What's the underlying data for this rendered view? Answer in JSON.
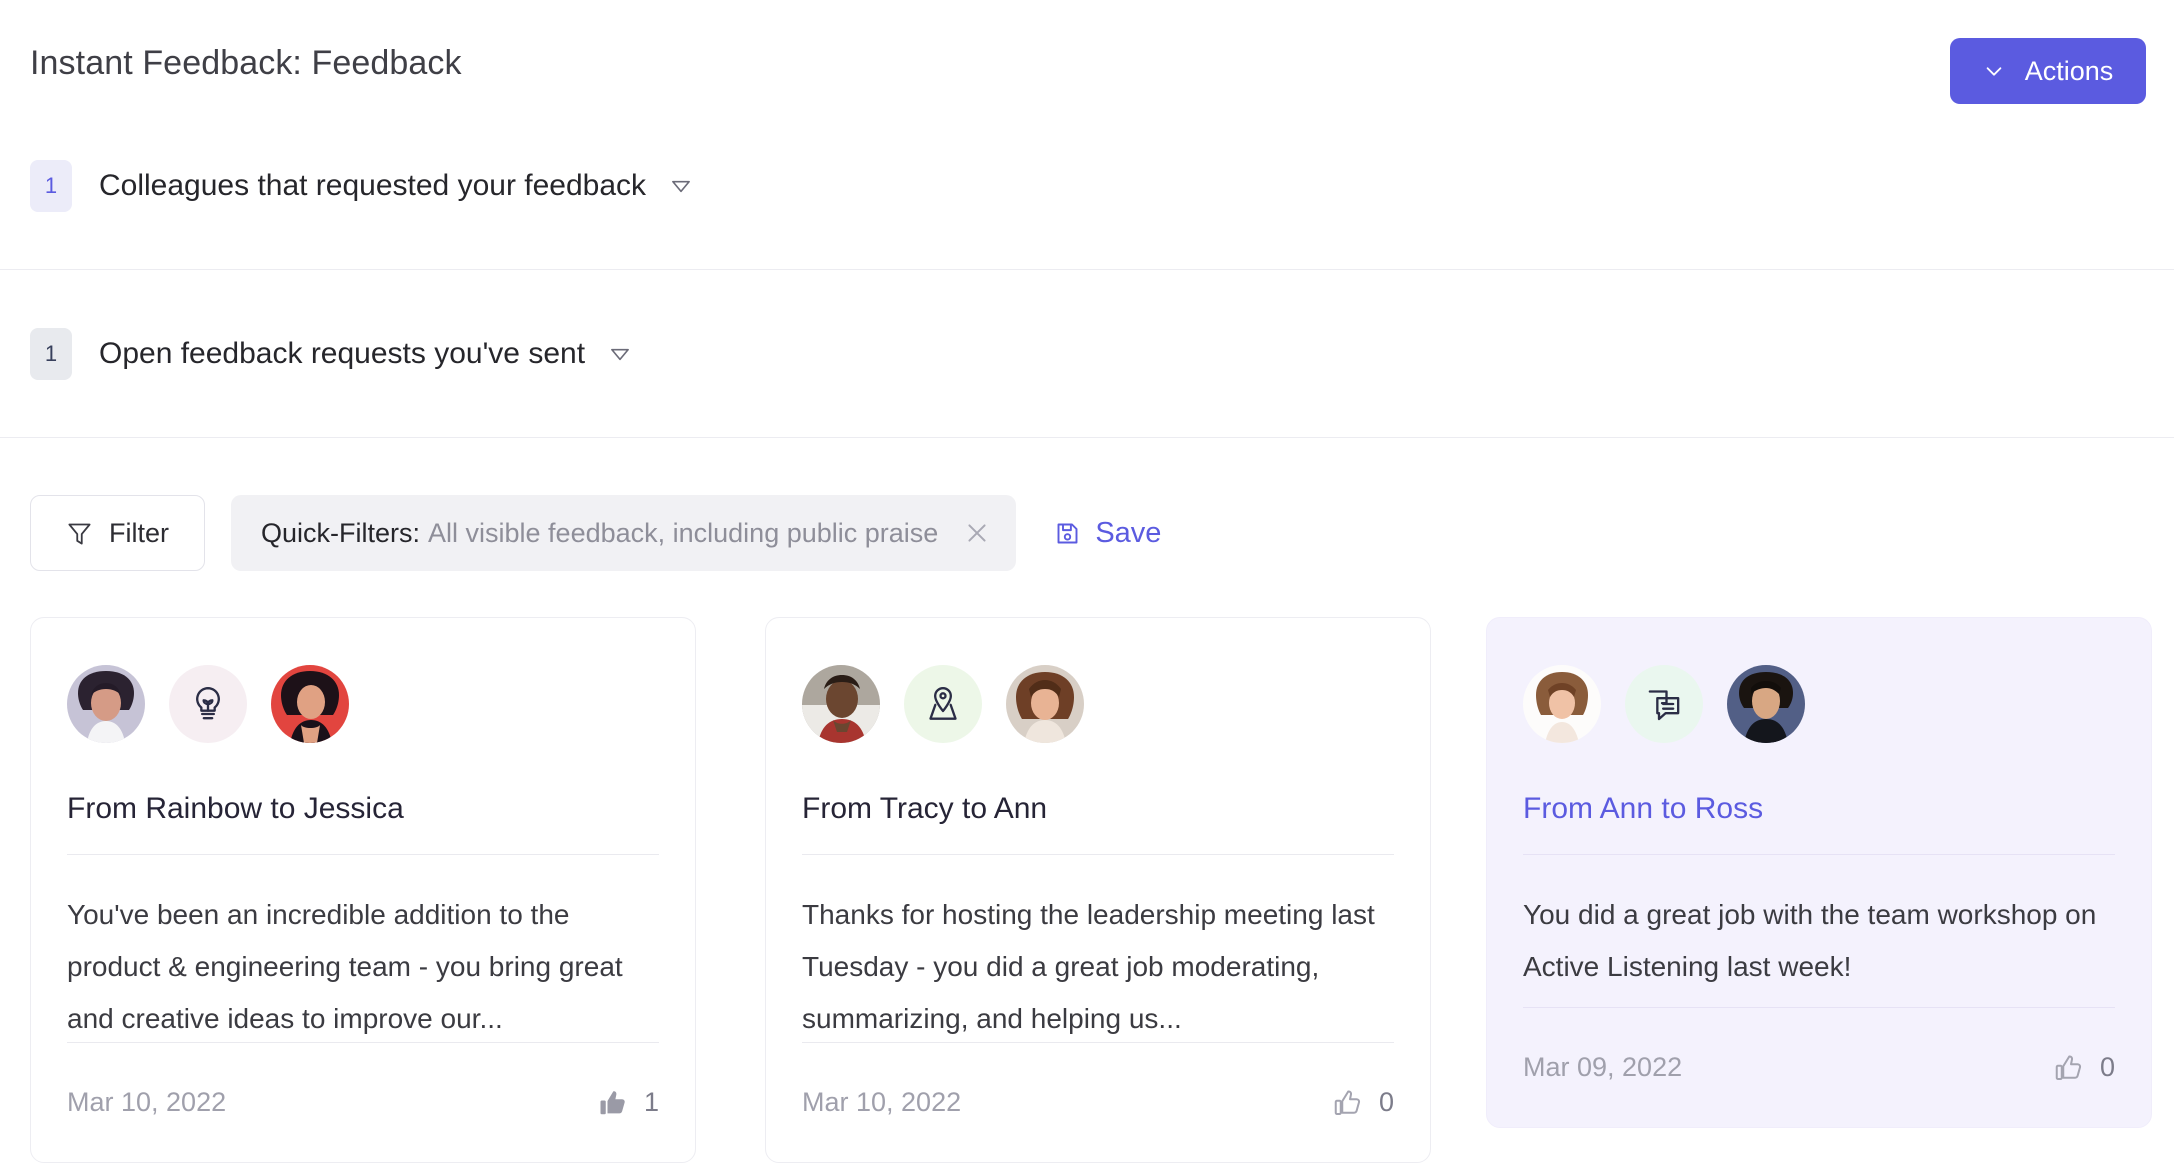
{
  "header": {
    "title": "Instant Feedback: Feedback",
    "actions_label": "Actions",
    "actions_icon": "chevron-down-icon",
    "accent_color": "#5b5be0"
  },
  "sections": [
    {
      "count": "1",
      "label": "Colleagues that requested your feedback",
      "badge_style": "purple",
      "chevron_icon": "chevron-down-icon"
    },
    {
      "count": "1",
      "label": "Open feedback requests you've sent",
      "badge_style": "grey",
      "chevron_icon": "chevron-down-icon"
    }
  ],
  "filter_bar": {
    "filter_label": "Filter",
    "filter_icon": "funnel-icon",
    "quick_filters_label": "Quick-Filters:",
    "quick_filters_value": "All visible feedback, including public praise",
    "clear_icon": "close-icon",
    "save_label": "Save",
    "save_icon": "save-disk-icon"
  },
  "cards": [
    {
      "title": "From Rainbow to Jessica",
      "body": "You've been an incredible addition to the product & engineering team - you bring great and creative ideas to improve our...",
      "date": "Mar 10, 2022",
      "likes": "1",
      "liked": true,
      "like_icon": "thumbs-up-filled-icon",
      "badge_icon": "lightbulb-icon",
      "badge_bg": "#f6eef2",
      "from_avatar": "avatar-rainbow",
      "to_avatar": "avatar-jessica",
      "highlighted": false
    },
    {
      "title": "From Tracy to Ann",
      "body": "Thanks for hosting the leadership meeting last Tuesday - you did a great job moderating, summarizing, and helping us...",
      "date": "Mar 10, 2022",
      "likes": "0",
      "liked": false,
      "like_icon": "thumbs-up-outline-icon",
      "badge_icon": "map-pin-icon",
      "badge_bg": "#edf7e8",
      "from_avatar": "avatar-tracy",
      "to_avatar": "avatar-ann",
      "highlighted": false
    },
    {
      "title": "From Ann to Ross",
      "body": "You did a great job with the team workshop on Active Listening last week!",
      "date": "Mar 09, 2022",
      "likes": "0",
      "liked": false,
      "like_icon": "thumbs-up-outline-icon",
      "badge_icon": "chat-bubbles-icon",
      "badge_bg": "#eaf7ef",
      "from_avatar": "avatar-ann",
      "to_avatar": "avatar-ross",
      "highlighted": true
    }
  ]
}
